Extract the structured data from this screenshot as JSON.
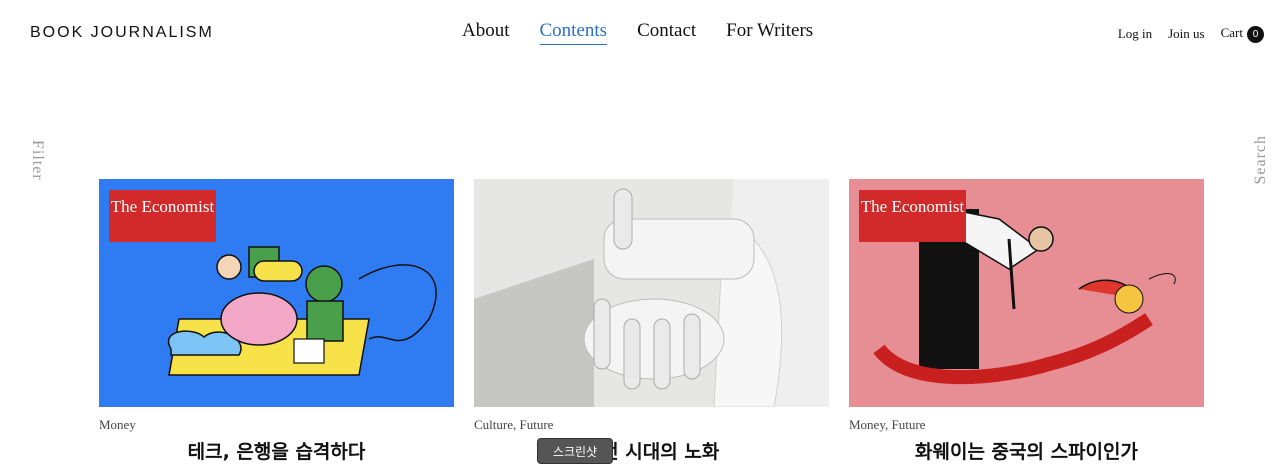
{
  "header": {
    "logo": "BOOK JOURNALISM",
    "nav": [
      "About",
      "Contents",
      "Contact",
      "For Writers"
    ],
    "active_nav": "Contents",
    "account": {
      "login": "Log in",
      "join": "Join us",
      "cart": "Cart",
      "cart_count": "0"
    }
  },
  "side": {
    "filter": "Filter",
    "search": "Search"
  },
  "cards": [
    {
      "badge": "The Economist",
      "category": "Money",
      "title": "테크, 은행을 습격하다",
      "bg": "#2f7cf2"
    },
    {
      "badge": "",
      "category": "Culture, Future",
      "title": "휴먼 시대의 노화",
      "bg": "#dcdcdc"
    },
    {
      "badge": "The Economist",
      "category": "Money, Future",
      "title": "화웨이는 중국의 스파이인가",
      "bg": "#e78d94"
    }
  ],
  "tooltip": "스크린샷"
}
